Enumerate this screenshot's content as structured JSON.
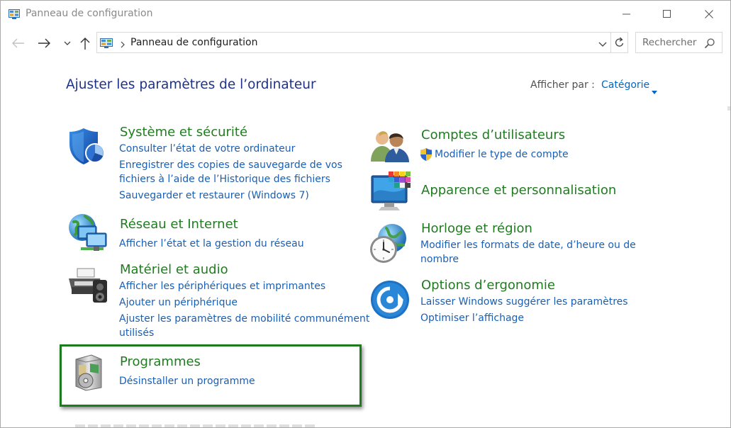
{
  "window": {
    "title": "Panneau de configuration"
  },
  "address_bar": {
    "path": "Panneau de configuration"
  },
  "search": {
    "placeholder": "Rechercher"
  },
  "main": {
    "title": "Ajuster les paramètres de l’ordinateur",
    "view_by_label": "Afficher par :",
    "view_by_value": "Catégorie"
  },
  "categories": {
    "system": {
      "title": "Système et sécurité",
      "icon": "shield-icon",
      "links": [
        "Consulter l’état de votre ordinateur",
        "Enregistrer des copies de sauvegarde de vos",
        "fichiers à l’aide de l’Historique des fichiers",
        "Sauvegarder et restaurer (Windows 7)"
      ]
    },
    "network": {
      "title": "Réseau et Internet",
      "icon": "network-globe-icon",
      "links": [
        "Afficher l’état et la gestion du réseau"
      ]
    },
    "hardware": {
      "title": "Matériel et audio",
      "icon": "printer-speaker-icon",
      "links": [
        "Afficher les périphériques et imprimantes",
        "Ajouter un périphérique",
        "Ajuster les paramètres de mobilité communément",
        "utilisés"
      ]
    },
    "programs": {
      "title": "Programmes",
      "icon": "programs-disc-icon",
      "links": [
        "Désinstaller un programme"
      ]
    },
    "accounts": {
      "title": "Comptes d’utilisateurs",
      "icon": "users-icon",
      "links": [
        "Modifier le type de compte"
      ]
    },
    "appearance": {
      "title": "Apparence et personnalisation",
      "icon": "monitor-palette-icon",
      "links": []
    },
    "clock": {
      "title": "Horloge et région",
      "icon": "clock-globe-icon",
      "links": [
        "Modifier les formats de date, d’heure ou de",
        "nombre"
      ]
    },
    "ease": {
      "title": "Options d’ergonomie",
      "icon": "ease-of-access-icon",
      "links": [
        "Laisser Windows suggérer les paramètres",
        "Optimiser l’affichage"
      ]
    }
  },
  "colors": {
    "category_title": "#1f7d1f",
    "link": "#1a5fb4",
    "page_title": "#1e3287",
    "highlight_border": "#1d7a1d"
  }
}
